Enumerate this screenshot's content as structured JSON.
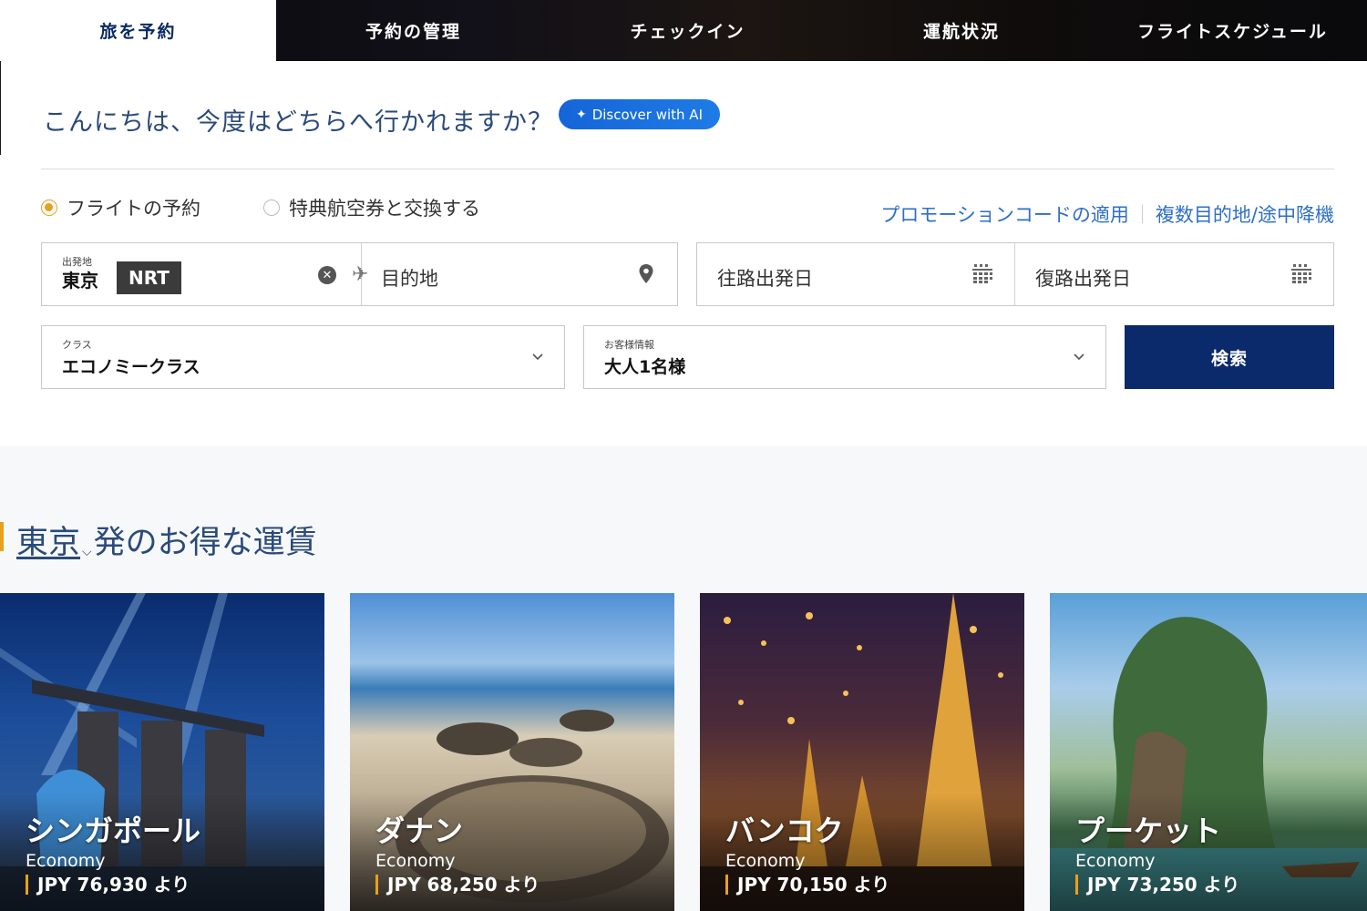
{
  "tabs": [
    {
      "label": "旅を予約"
    },
    {
      "label": "予約の管理"
    },
    {
      "label": "チェックイン"
    },
    {
      "label": "運航状況"
    },
    {
      "label": "フライトスケジュール"
    }
  ],
  "greeting": "こんにちは、今度はどちらへ行かれますか？",
  "ai_button": {
    "label": "Discover with AI",
    "icon": "sparkle-icon"
  },
  "trip_type": {
    "options": [
      {
        "label": "フライトの予約",
        "selected": true
      },
      {
        "label": "特典航空券と交換する",
        "selected": false
      }
    ]
  },
  "links": {
    "promo": "プロモーションコードの適用",
    "multi_city": "複数目的地/途中降機"
  },
  "origin": {
    "label": "出発地",
    "city": "東京",
    "code": "NRT"
  },
  "destination": {
    "placeholder": "目的地"
  },
  "dates": {
    "outbound": "往路出発日",
    "return": "復路出発日"
  },
  "cabin": {
    "label": "クラス",
    "value": "エコノミークラス"
  },
  "passengers": {
    "label": "お客様情報",
    "value": "大人1名様"
  },
  "search_button": "検索",
  "deals": {
    "city": "東京",
    "title_suffix": "発のお得な運賃",
    "cards": [
      {
        "name": "シンガポール",
        "cabin": "Economy",
        "price": "JPY 76,930 より"
      },
      {
        "name": "ダナン",
        "cabin": "Economy",
        "price": "JPY 68,250 より"
      },
      {
        "name": "バンコク",
        "cabin": "Economy",
        "price": "JPY 70,150 より"
      },
      {
        "name": "プーケット",
        "cabin": "Economy",
        "price": "JPY 73,250 より"
      }
    ]
  },
  "colors": {
    "brand_navy": "#0b2a6b",
    "accent_gold": "#e9a01d",
    "link_blue": "#2e6fc7",
    "ai_blue": "#1565d8"
  }
}
